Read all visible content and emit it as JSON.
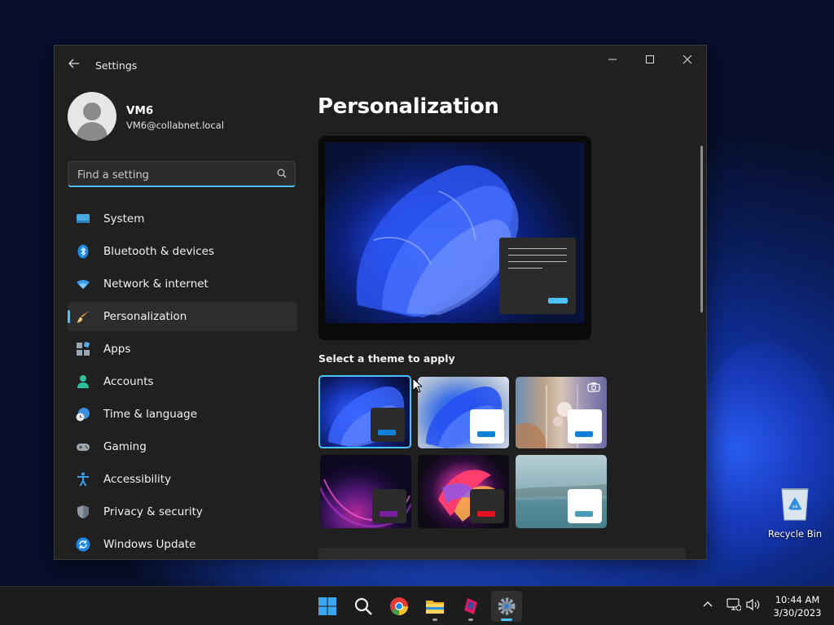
{
  "window": {
    "title": "Settings",
    "minimize_icon": "minimize-icon",
    "maximize_icon": "maximize-icon",
    "close_icon": "close-icon"
  },
  "profile": {
    "name": "VM6",
    "email": "VM6@collabnet.local"
  },
  "search": {
    "placeholder": "Find a setting",
    "value": ""
  },
  "sidebar": {
    "items": [
      {
        "label": "System",
        "icon": "system-icon"
      },
      {
        "label": "Bluetooth & devices",
        "icon": "bluetooth-icon"
      },
      {
        "label": "Network & internet",
        "icon": "wifi-icon"
      },
      {
        "label": "Personalization",
        "icon": "brush-icon",
        "active": true
      },
      {
        "label": "Apps",
        "icon": "apps-icon"
      },
      {
        "label": "Accounts",
        "icon": "accounts-icon"
      },
      {
        "label": "Time & language",
        "icon": "clock-globe-icon"
      },
      {
        "label": "Gaming",
        "icon": "gamepad-icon"
      },
      {
        "label": "Accessibility",
        "icon": "accessibility-icon"
      },
      {
        "label": "Privacy & security",
        "icon": "shield-icon"
      },
      {
        "label": "Windows Update",
        "icon": "update-icon"
      }
    ]
  },
  "main": {
    "page_title": "Personalization",
    "theme_section_label": "Select a theme to apply",
    "themes": [
      {
        "name": "windows-dark",
        "selected": true,
        "button_color": "#0f7fd8",
        "mini_bg": "#2b2b2b"
      },
      {
        "name": "windows-light",
        "selected": false,
        "button_color": "#0f7fd8",
        "mini_bg": "#ffffff"
      },
      {
        "name": "windows-spotlight",
        "selected": false,
        "button_color": "#0f7fd8",
        "mini_bg": "#ffffff",
        "camera_icon": "camera-icon"
      },
      {
        "name": "glow",
        "selected": false,
        "button_color": "#7b1fa2",
        "mini_bg": "#2b2b2b"
      },
      {
        "name": "captured-motion",
        "selected": false,
        "button_color": "#e01222",
        "mini_bg": "#2b2b2b"
      },
      {
        "name": "flow",
        "selected": false,
        "button_color": "#4a9bb8",
        "mini_bg": "#ffffff"
      }
    ]
  },
  "desktop": {
    "recycle_bin_label": "Recycle Bin"
  },
  "taskbar": {
    "apps": [
      "start-icon",
      "search-icon",
      "chrome-icon",
      "file-explorer-icon",
      "app-icon",
      "settings-icon"
    ],
    "time": "10:44 AM",
    "date": "3/30/2023"
  },
  "colors": {
    "accent": "#4cc2ff",
    "window_bg": "#202020",
    "taskbar_bg": "#1c1c1c"
  }
}
